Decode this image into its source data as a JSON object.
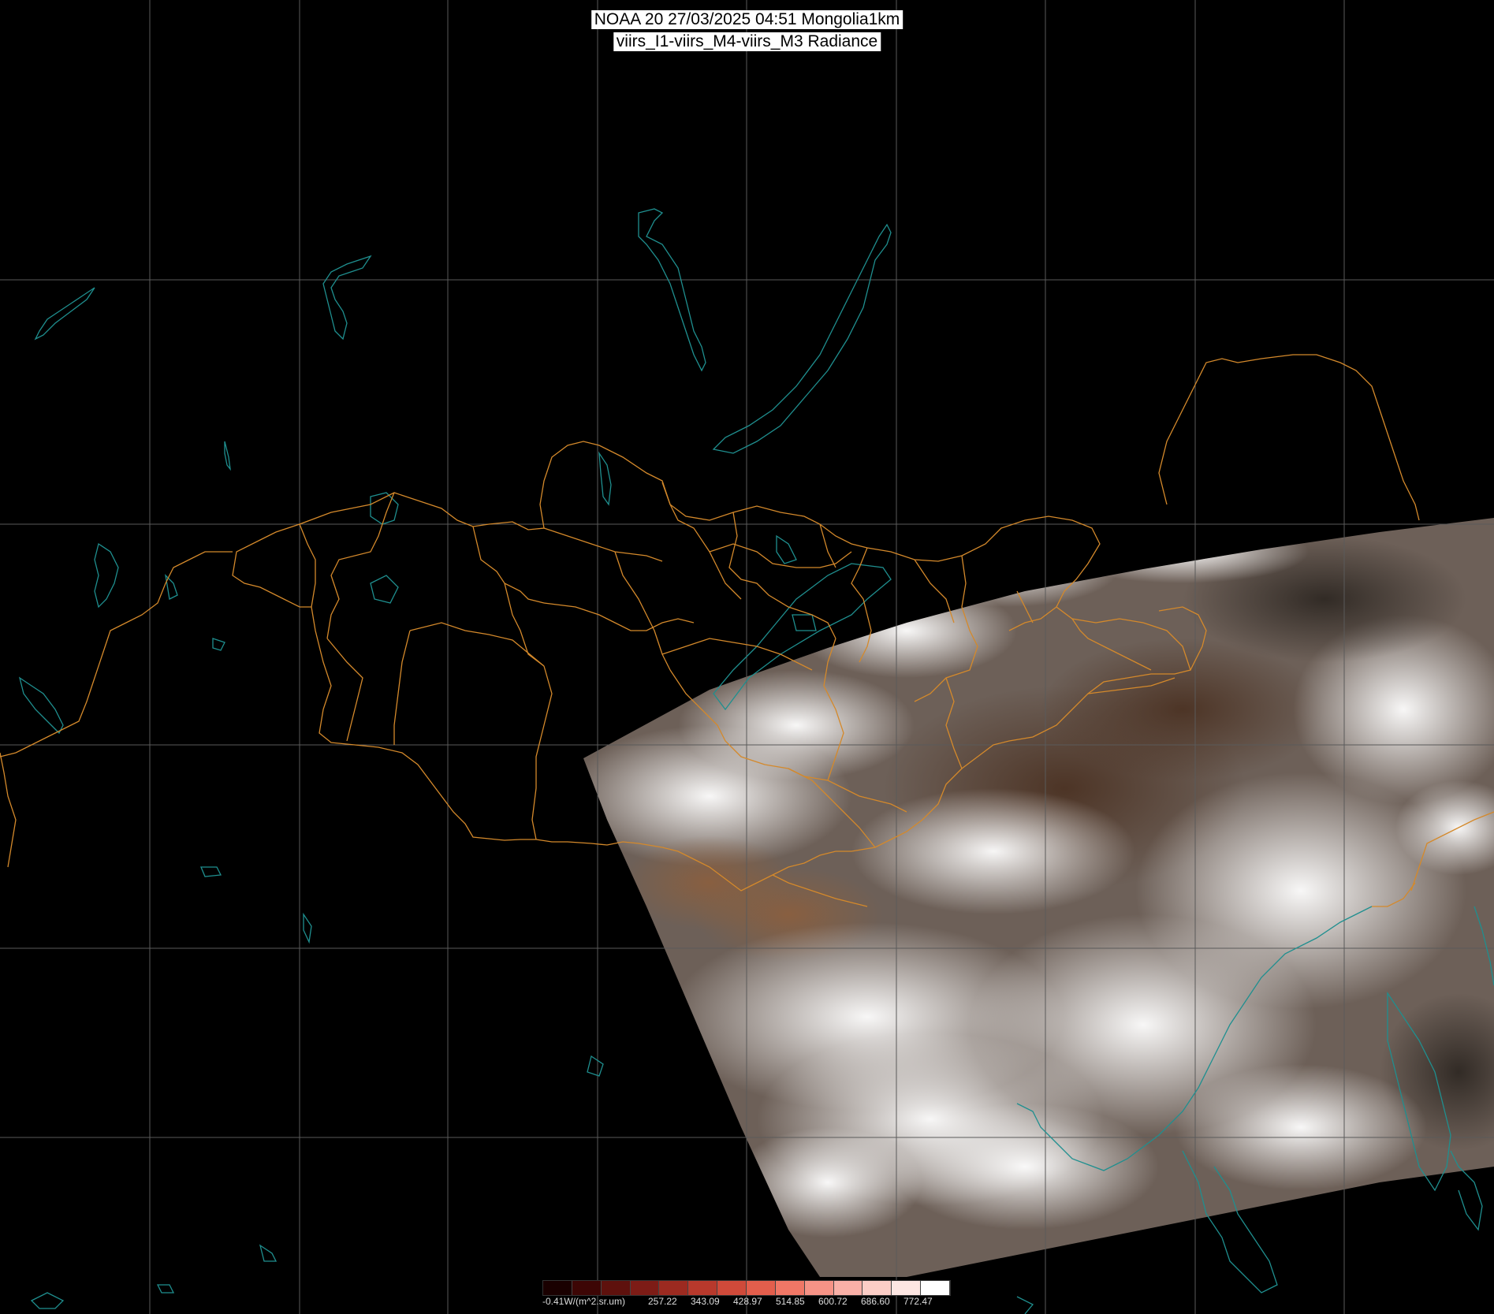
{
  "title": {
    "line1": "NOAA 20 27/03/2025 04:51 Mongolia1km",
    "line2": "viirs_I1-viirs_M4-viirs_M3 Radiance"
  },
  "legend": {
    "unit_label": "-0.41W/(m^2.sr.um)",
    "ticks": [
      "257.22",
      "343.09",
      "428.97",
      "514.85",
      "600.72",
      "686.60",
      "772.47"
    ],
    "colors": [
      "#1a0000",
      "#3d0605",
      "#5e110d",
      "#7d1c16",
      "#9c2a20",
      "#b8392c",
      "#cf4a3a",
      "#e35e4c",
      "#f07766",
      "#f69386",
      "#f9b0a7",
      "#fbcdc6",
      "#fde6e2",
      "#ffffff"
    ]
  },
  "map": {
    "background": "#000000",
    "graticule_color": "#5a5a5a",
    "coastline_color": "#1f8f8f",
    "border_color": "#d4892b"
  }
}
